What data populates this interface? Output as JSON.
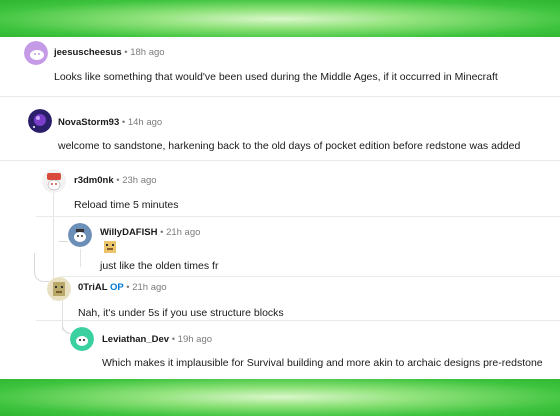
{
  "comments": [
    {
      "username": "jeesuscheesus",
      "op_badge": "",
      "separator": "•",
      "time": "18h ago",
      "text": "Looks like something that would've been used during the Middle Ages, if it occurred in Minecraft",
      "avatar_color": "#c59be8"
    },
    {
      "username": "NovaStorm93",
      "op_badge": "",
      "separator": "•",
      "time": "14h ago",
      "text": "welcome to sandstone, harkening back to the old days of pocket edition before redstone was added",
      "avatar_color": "#2b1f6b"
    },
    {
      "username": "r3dm0nk",
      "op_badge": "",
      "separator": "•",
      "time": "23h ago",
      "text": "Reload time 5 minutes",
      "avatar_color": "#d94a3a"
    },
    {
      "username": "WillyDAFISH",
      "op_badge": "",
      "separator": "•",
      "time": "21h ago",
      "text": "just like the olden times fr",
      "avatar_color": "#6c8fb8"
    },
    {
      "username": "0TriAL",
      "op_badge": "OP",
      "separator": "•",
      "time": "21h ago",
      "text": "Nah, it's under 5s if you use structure blocks",
      "avatar_color": "#b8a86a"
    },
    {
      "username": "Leviathan_Dev",
      "op_badge": "",
      "separator": "•",
      "time": "19h ago",
      "text": "Which makes it implausible for Survival building and more akin to archaic designs pre-redstone",
      "avatar_color": "#3ad0a0"
    }
  ],
  "colors": {
    "background_green": "#3fc43f",
    "op_blue": "#0079d3"
  }
}
